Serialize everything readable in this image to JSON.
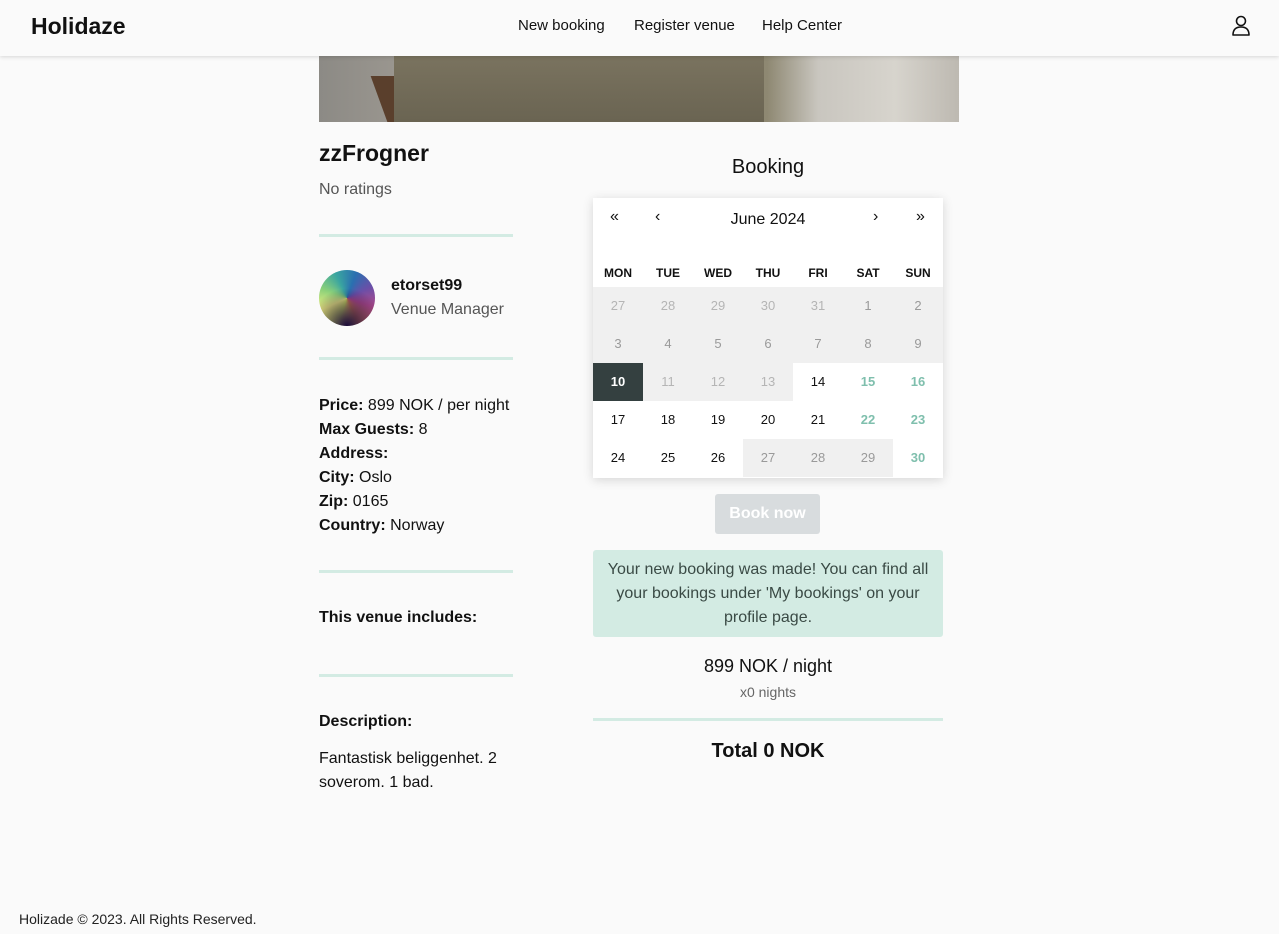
{
  "header": {
    "logo": "Holidaze",
    "nav": [
      "New booking",
      "Register venue",
      "Help Center"
    ],
    "user_icon": "user-icon"
  },
  "venue": {
    "name": "zzFrogner",
    "ratings": "No ratings"
  },
  "manager": {
    "name": "etorset99",
    "role": "Venue Manager"
  },
  "details": {
    "price_label": "Price:",
    "price_value": "899 NOK / per night",
    "guests_label": "Max Guests:",
    "guests_value": "8",
    "address_label": "Address:",
    "city_label": "City:",
    "city_value": "Oslo",
    "zip_label": "Zip:",
    "zip_value": "0165",
    "country_label": "Country:",
    "country_value": "Norway"
  },
  "includes_heading": "This venue includes:",
  "description": {
    "heading": "Description:",
    "text": "Fantastisk beliggenhet. 2 soverom. 1 bad."
  },
  "booking": {
    "heading": "Booking",
    "calendar": {
      "nav_first": "«",
      "nav_prev": "‹",
      "nav_next": "›",
      "nav_last": "»",
      "month": "June 2024",
      "weekdays": [
        "MON",
        "TUE",
        "WED",
        "THU",
        "FRI",
        "SAT",
        "SUN"
      ],
      "weeks": [
        [
          {
            "d": "27",
            "s": "past"
          },
          {
            "d": "28",
            "s": "past"
          },
          {
            "d": "29",
            "s": "past"
          },
          {
            "d": "30",
            "s": "past"
          },
          {
            "d": "31",
            "s": "past"
          },
          {
            "d": "1",
            "s": "pastcur"
          },
          {
            "d": "2",
            "s": "pastcur"
          }
        ],
        [
          {
            "d": "3",
            "s": "pastcur"
          },
          {
            "d": "4",
            "s": "pastcur"
          },
          {
            "d": "5",
            "s": "pastcur"
          },
          {
            "d": "6",
            "s": "pastcur"
          },
          {
            "d": "7",
            "s": "pastcur"
          },
          {
            "d": "8",
            "s": "pastcur"
          },
          {
            "d": "9",
            "s": "pastcur"
          }
        ],
        [
          {
            "d": "10",
            "s": "today"
          },
          {
            "d": "11",
            "s": "past"
          },
          {
            "d": "12",
            "s": "past"
          },
          {
            "d": "13",
            "s": "past"
          },
          {
            "d": "14",
            "s": "normal"
          },
          {
            "d": "15",
            "s": "weekend"
          },
          {
            "d": "16",
            "s": "weekend"
          }
        ],
        [
          {
            "d": "17",
            "s": "normal"
          },
          {
            "d": "18",
            "s": "normal"
          },
          {
            "d": "19",
            "s": "normal"
          },
          {
            "d": "20",
            "s": "normal"
          },
          {
            "d": "21",
            "s": "normal"
          },
          {
            "d": "22",
            "s": "weekend"
          },
          {
            "d": "23",
            "s": "weekend"
          }
        ],
        [
          {
            "d": "24",
            "s": "normal"
          },
          {
            "d": "25",
            "s": "normal"
          },
          {
            "d": "26",
            "s": "normal"
          },
          {
            "d": "27",
            "s": "pastcur"
          },
          {
            "d": "28",
            "s": "pastcur"
          },
          {
            "d": "29",
            "s": "pastcur"
          },
          {
            "d": "30",
            "s": "weekend"
          }
        ]
      ]
    },
    "book_button": "Book now",
    "success_message": "Your new booking was made! You can find all your bookings under 'My bookings' on your profile page.",
    "price_per_night": "899 NOK / night",
    "nights": "x0 nights",
    "total": "Total 0 NOK"
  },
  "footer": "Holizade © 2023. All Rights Reserved.",
  "colors": {
    "accent": "#d3ebe3",
    "today": "#344040",
    "weekend": "#7fbfad"
  }
}
